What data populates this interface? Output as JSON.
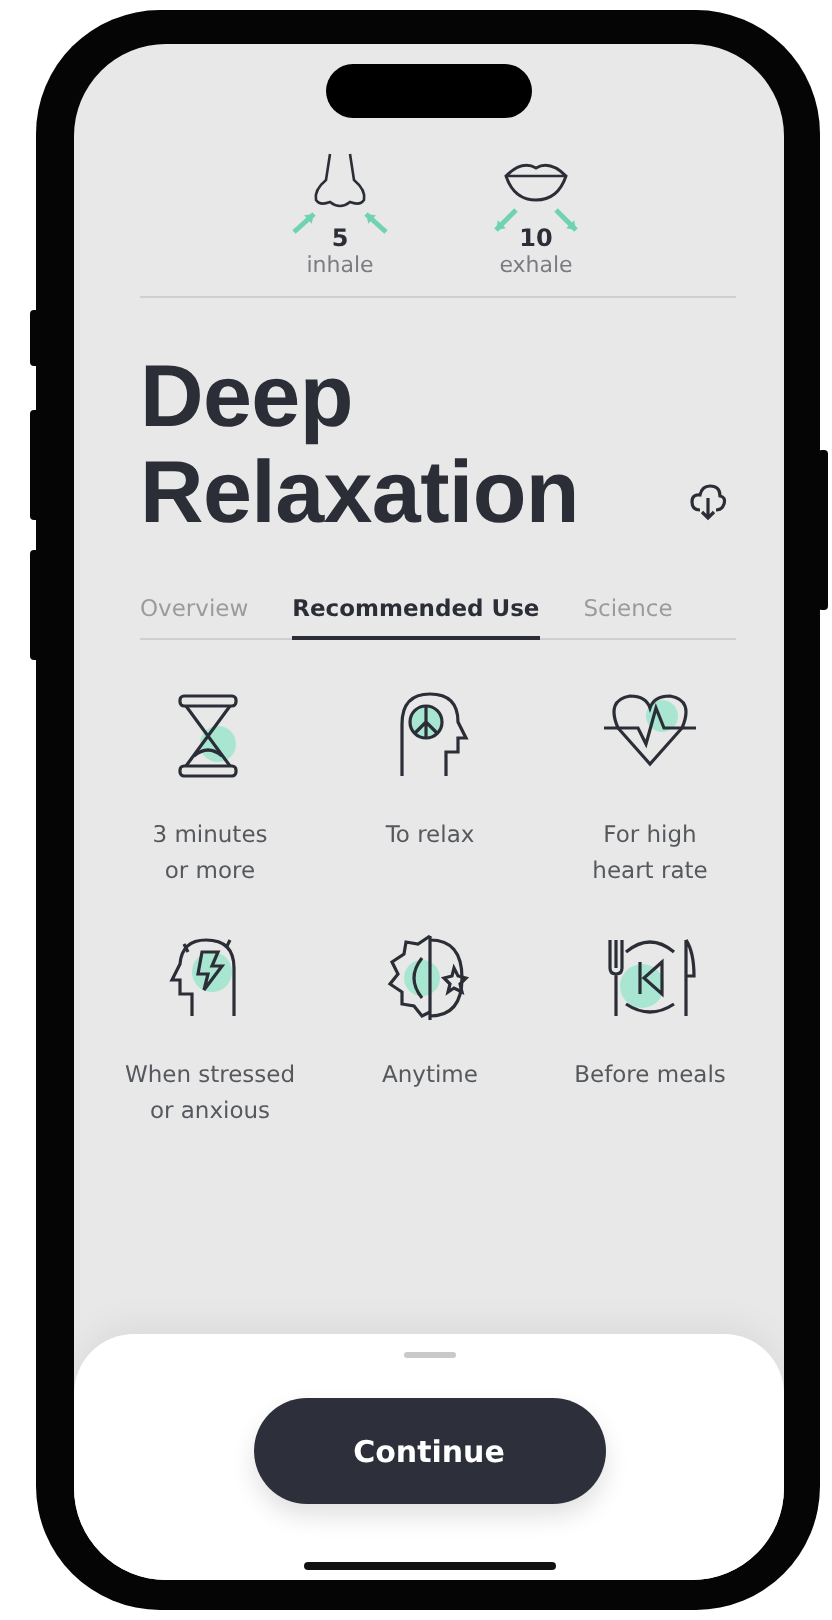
{
  "breathing": [
    {
      "kind": "inhale",
      "count": "5",
      "label": "inhale"
    },
    {
      "kind": "exhale",
      "count": "10",
      "label": "exhale"
    }
  ],
  "title": "Deep\nRelaxation",
  "tabs": [
    {
      "label": "Overview",
      "selected": false
    },
    {
      "label": "Recommended Use",
      "selected": true
    },
    {
      "label": "Science",
      "selected": false
    }
  ],
  "uses": [
    {
      "kind": "hourglass",
      "label": "3 minutes\nor more"
    },
    {
      "kind": "peace",
      "label": "To relax"
    },
    {
      "kind": "heart",
      "label": "For high\nheart rate"
    },
    {
      "kind": "stress",
      "label": "When stressed\nor anxious"
    },
    {
      "kind": "daynight",
      "label": "Anytime"
    },
    {
      "kind": "meal",
      "label": "Before meals"
    }
  ],
  "button": "Continue"
}
